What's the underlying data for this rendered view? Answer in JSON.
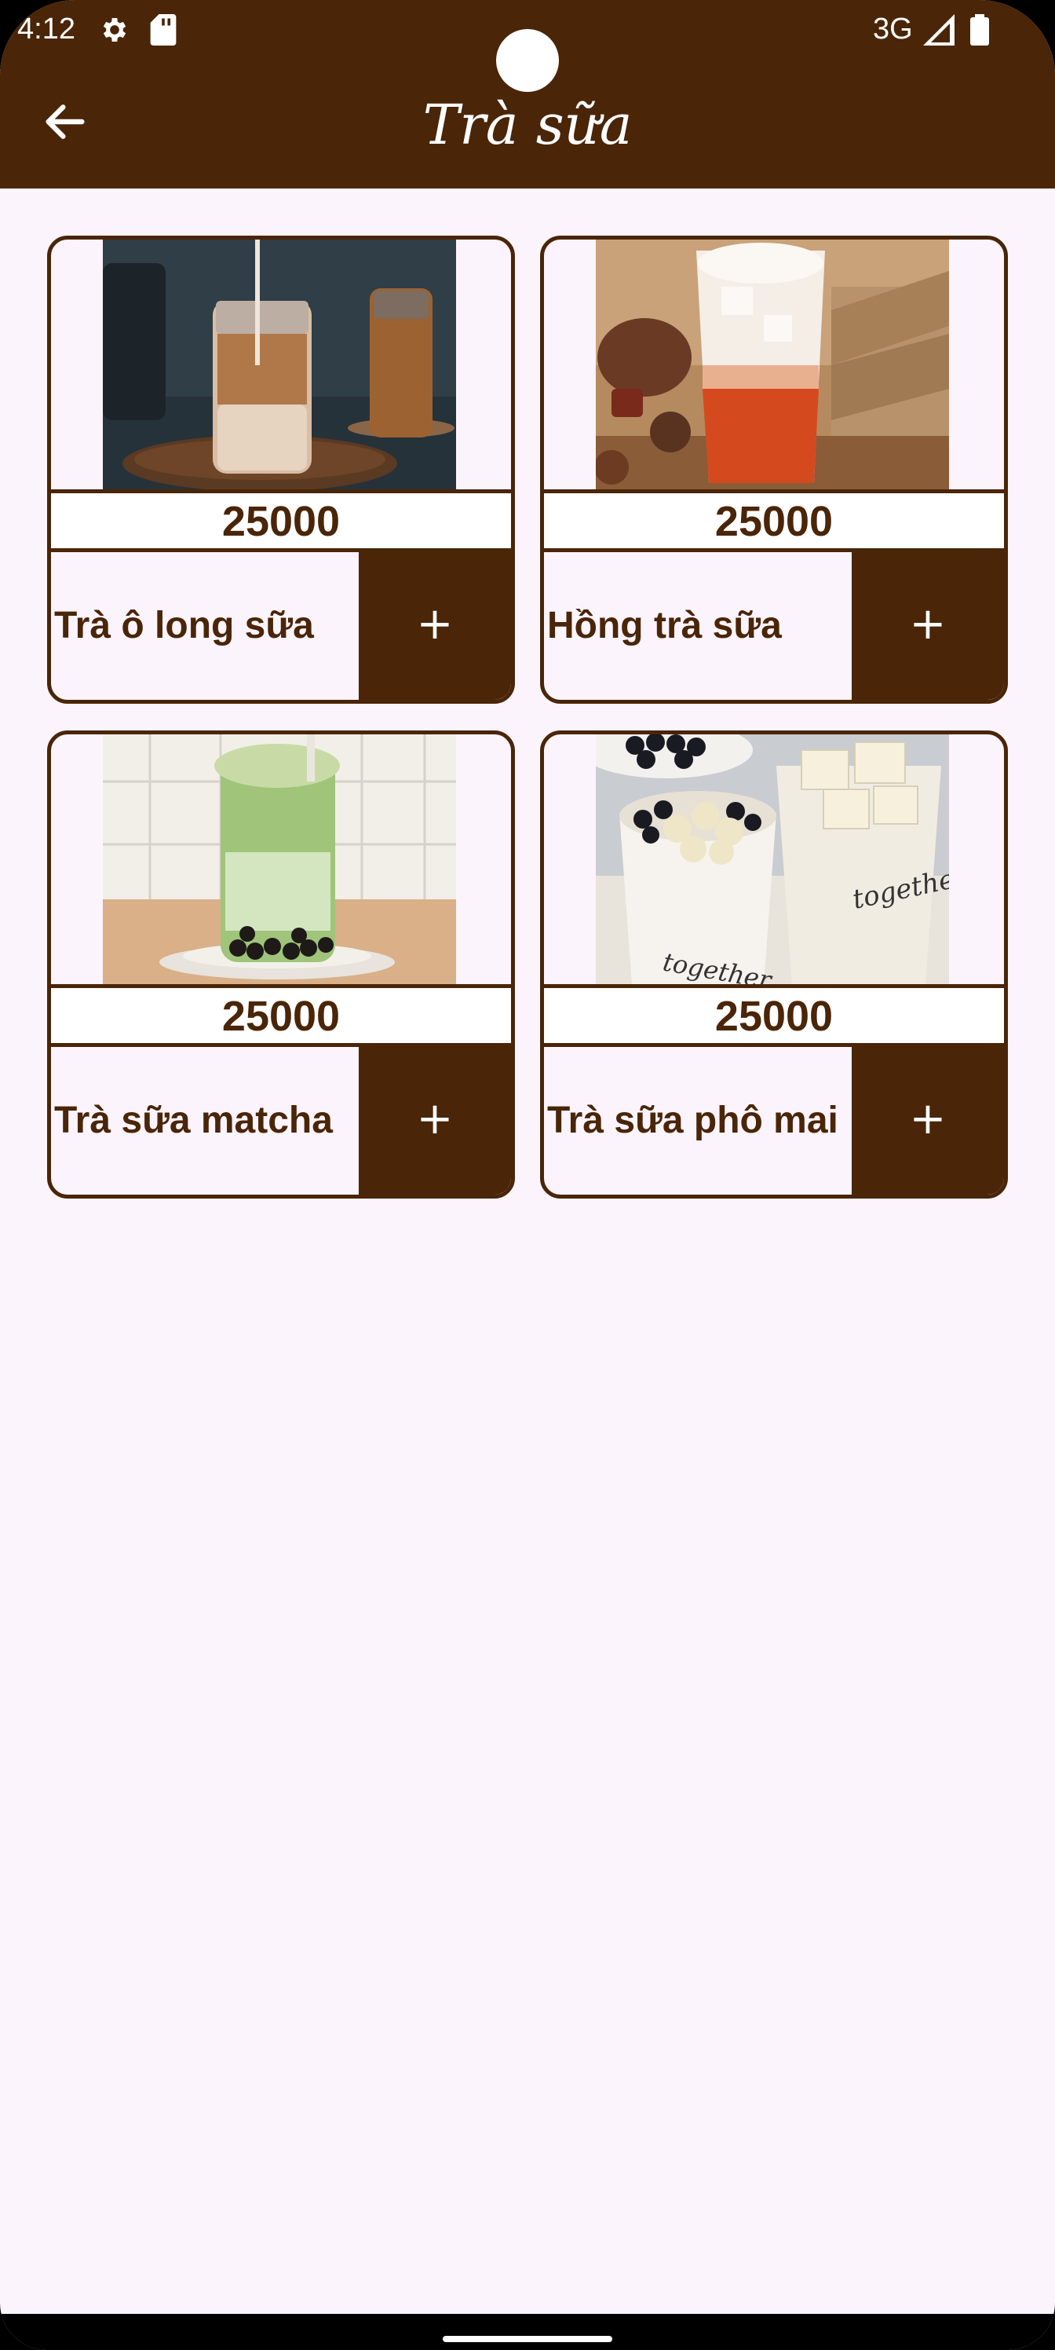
{
  "status_bar": {
    "time": "4:12",
    "network": "3G",
    "icons": [
      "gear-icon",
      "sd-card-icon",
      "signal-icon",
      "battery-icon"
    ]
  },
  "app_bar": {
    "title": "Trà sữa",
    "back_icon": "arrow-back-icon",
    "color": "#4a2508"
  },
  "products": [
    {
      "name": "Trà ô long sữa",
      "price": "25000",
      "add_label": "+",
      "image": "iced-milk-tea-jar-photo"
    },
    {
      "name": "Hồng trà sữa",
      "price": "25000",
      "add_label": "+",
      "image": "black-milk-tea-cup-photo"
    },
    {
      "name": "Trà sữa matcha",
      "price": "25000",
      "add_label": "+",
      "image": "matcha-milk-tea-photo"
    },
    {
      "name": "Trà sữa phô mai",
      "price": "25000",
      "add_label": "+",
      "image": "cheese-milk-tea-cups-photo"
    }
  ],
  "colors": {
    "brand": "#4a2508",
    "background": "#fcf4fc",
    "price_bg": "#ffffff"
  }
}
